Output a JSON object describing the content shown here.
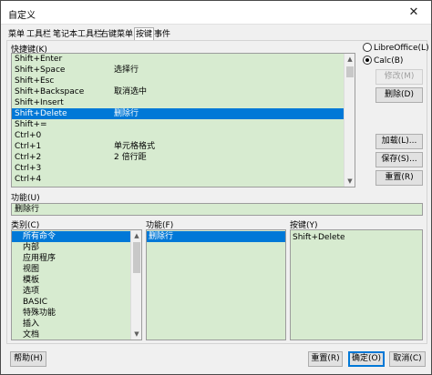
{
  "window": {
    "title": "自定义",
    "close_glyph": "✕"
  },
  "tabs": [
    {
      "label": "菜单",
      "active": false
    },
    {
      "label": "工具栏",
      "active": false
    },
    {
      "label": "笔记本工具栏",
      "active": false
    },
    {
      "label": "右键菜单",
      "active": false
    },
    {
      "label": "按键",
      "active": true
    },
    {
      "label": "事件",
      "active": false
    }
  ],
  "shortcuts": {
    "label": "快捷键(K)",
    "rows": [
      {
        "key": "Shift+Enter",
        "cmd": ""
      },
      {
        "key": "Shift+Space",
        "cmd": "选择行"
      },
      {
        "key": "Shift+Esc",
        "cmd": ""
      },
      {
        "key": "Shift+Backspace",
        "cmd": "取消选中"
      },
      {
        "key": "Shift+Insert",
        "cmd": ""
      },
      {
        "key": "Shift+Delete",
        "cmd": "删除行",
        "selected": true
      },
      {
        "key": "Shift+=",
        "cmd": ""
      },
      {
        "key": "Ctrl+0",
        "cmd": ""
      },
      {
        "key": "Ctrl+1",
        "cmd": "单元格格式"
      },
      {
        "key": "Ctrl+2",
        "cmd": "2 倍行距"
      },
      {
        "key": "Ctrl+3",
        "cmd": ""
      },
      {
        "key": "Ctrl+4",
        "cmd": ""
      }
    ]
  },
  "scope": {
    "libreoffice": "LibreOffice(L)",
    "calc": "Calc(B)",
    "selected": "calc"
  },
  "buttons": {
    "modify": "修改(M)",
    "delete": "删除(D)",
    "load": "加载(L)...",
    "save": "保存(S)...",
    "reset_side": "重置(R)",
    "help": "帮助(H)",
    "reset": "重置(R)",
    "ok": "确定(O)",
    "cancel": "取消(C)"
  },
  "function_field": {
    "label": "功能(U)",
    "value": "删除行"
  },
  "category": {
    "label": "类别(C)",
    "items": [
      "所有命令",
      "内部",
      "应用程序",
      "视图",
      "模板",
      "选项",
      "BASIC",
      "特殊功能",
      "插入",
      "文档"
    ],
    "selected_index": 0
  },
  "functions": {
    "label": "功能(F)",
    "items": [
      "删除行"
    ],
    "selected_index": 0
  },
  "keys": {
    "label": "按键(Y)",
    "items": [
      "Shift+Delete"
    ]
  },
  "colors": {
    "list_bg": "#d7ebd0",
    "selection": "#0078d7",
    "dialog_bg": "#f0f0f0"
  }
}
